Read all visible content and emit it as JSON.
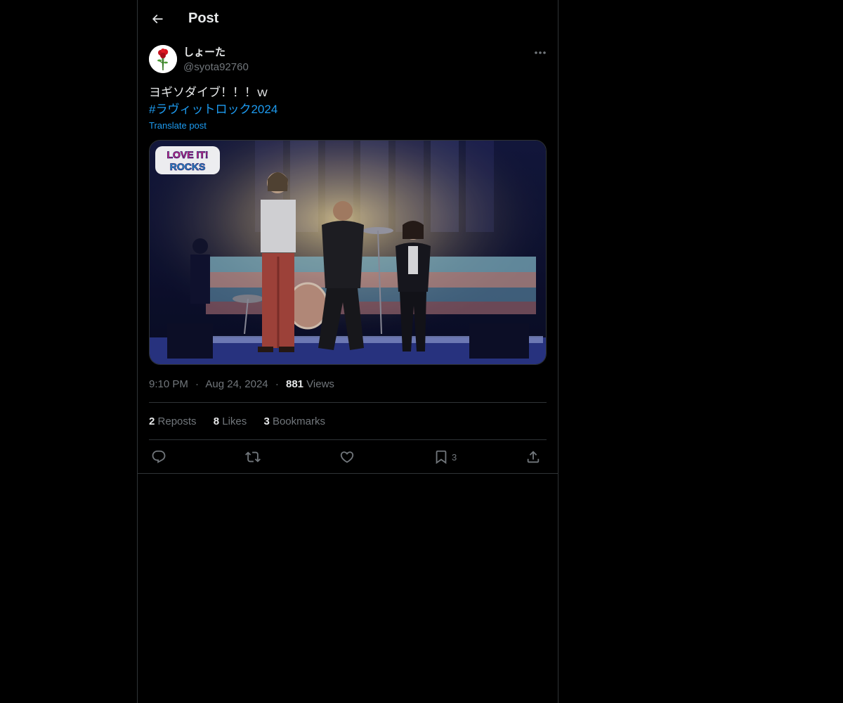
{
  "header": {
    "title": "Post"
  },
  "author": {
    "display_name": "しょーた",
    "handle": "@syota92760"
  },
  "post": {
    "text": "ヨギソダイブ！！！ｗ",
    "hashtag": "#ラヴィットロック2024",
    "translate_label": "Translate post",
    "media_logo_line1": "LOVE IT!",
    "media_logo_line2": "ROCKS"
  },
  "meta": {
    "time": "9:10 PM",
    "date": "Aug 24, 2024",
    "separator": "·",
    "views_count": "881",
    "views_label": "Views"
  },
  "stats": {
    "reposts_count": "2",
    "reposts_label": "Reposts",
    "likes_count": "8",
    "likes_label": "Likes",
    "bookmarks_count": "3",
    "bookmarks_label": "Bookmarks"
  },
  "actions": {
    "reply_icon": "reply-icon",
    "repost_icon": "repost-icon",
    "like_icon": "heart-icon",
    "bookmark_icon": "bookmark-icon",
    "bookmark_count": "3",
    "share_icon": "share-icon"
  },
  "colors": {
    "background": "#000000",
    "text": "#e7e9ea",
    "muted": "#71767b",
    "accent": "#1d9bf0",
    "border": "#2f3336"
  }
}
